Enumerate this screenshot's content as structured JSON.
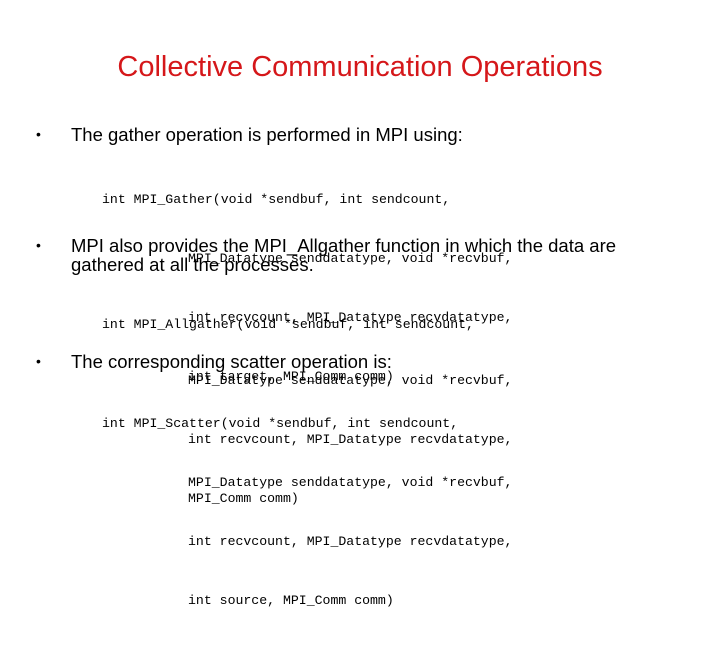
{
  "slide": {
    "title": "Collective Communication Operations",
    "title_color": "#d5171a",
    "bullet_glyph": "•",
    "bullets": [
      {
        "text": "The gather operation is performed in MPI using:",
        "code": [
          "int MPI_Gather(void *sendbuf, int sendcount,",
          "MPI_Datatype senddatatype, void *recvbuf,",
          "int recvcount, MPI_Datatype recvdatatype,",
          "int target, MPI_Comm comm)"
        ]
      },
      {
        "text": "MPI also provides the MPI_Allgather function in which the data are gathered at all the processes.",
        "code": [
          "int MPI_Allgather(void *sendbuf, int sendcount,",
          "MPI_Datatype senddatatype, void *recvbuf,",
          "int recvcount, MPI_Datatype recvdatatype,",
          "MPI_Comm comm)"
        ]
      },
      {
        "text": "The corresponding scatter operation is:",
        "code": [
          "int MPI_Scatter(void *sendbuf, int sendcount,",
          "MPI_Datatype senddatatype, void *recvbuf,",
          "int recvcount, MPI_Datatype recvdatatype,",
          "int source, MPI_Comm comm)"
        ]
      }
    ]
  }
}
